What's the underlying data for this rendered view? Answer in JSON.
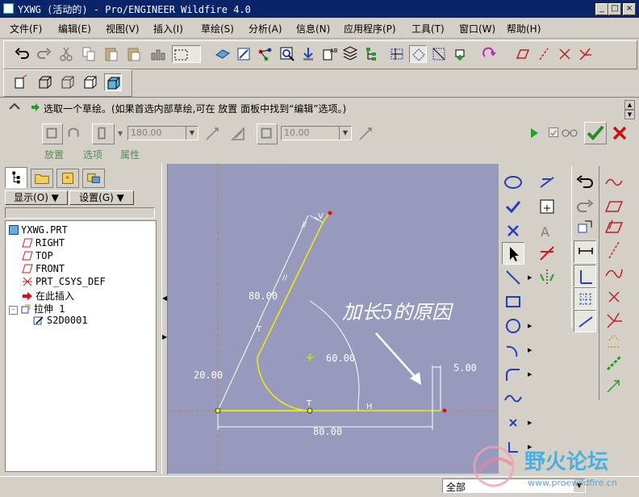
{
  "window": {
    "title": "YXWG (活动的) - Pro/ENGINEER Wildfire 4.0",
    "min": "_",
    "max": "□",
    "close": "×"
  },
  "menu": [
    "文件(F)",
    "编辑(E)",
    "视图(V)",
    "插入(I)",
    "草绘(S)",
    "分析(A)",
    "信息(N)",
    "应用程序(P)",
    "工具(T)",
    "窗口(W)",
    "帮助(H)"
  ],
  "dashboard": {
    "message": "选取一个草绘。(如果首选内部草绘,可在 放置 面板中找到“编辑”选项。)",
    "depth_value": "180.00",
    "thickness_value": "10.00",
    "tabs": [
      "放置",
      "选项",
      "属性"
    ]
  },
  "navigator": {
    "show_button": "显示(O) ▼",
    "settings_button": "设置(G) ▼",
    "tree": [
      {
        "label": "YXWG.PRT",
        "icon": "part-icon"
      },
      {
        "label": "RIGHT",
        "icon": "datum-plane-icon"
      },
      {
        "label": "TOP",
        "icon": "datum-plane-icon"
      },
      {
        "label": "FRONT",
        "icon": "datum-plane-icon"
      },
      {
        "label": "PRT_CSYS_DEF",
        "icon": "csys-icon"
      },
      {
        "label": "在此插入",
        "icon": "insert-here-arrow-icon"
      },
      {
        "label": "拉伸 1",
        "icon": "extrude-icon"
      },
      {
        "label": "S2D0001",
        "icon": "sketch-icon"
      }
    ]
  },
  "sketch": {
    "dims": {
      "top_len": "80.00",
      "radius": "60.00",
      "side": "20.00",
      "bottom": "80.00",
      "step": "5.00"
    },
    "constraints": [
      "V",
      "//",
      "//",
      "T",
      "T",
      "H"
    ],
    "annotation": "加长5的原因"
  },
  "status": {
    "filter": "全部"
  },
  "watermark": {
    "text": "野火论坛",
    "url": "www.proewildfire.cn"
  },
  "colors": {
    "title_bg": "#0a246a",
    "canvas_bg": "#9799bd",
    "sketch_line": "#f0f000",
    "accept_green": "#2a8a2a",
    "cancel_red": "#cc1010"
  }
}
